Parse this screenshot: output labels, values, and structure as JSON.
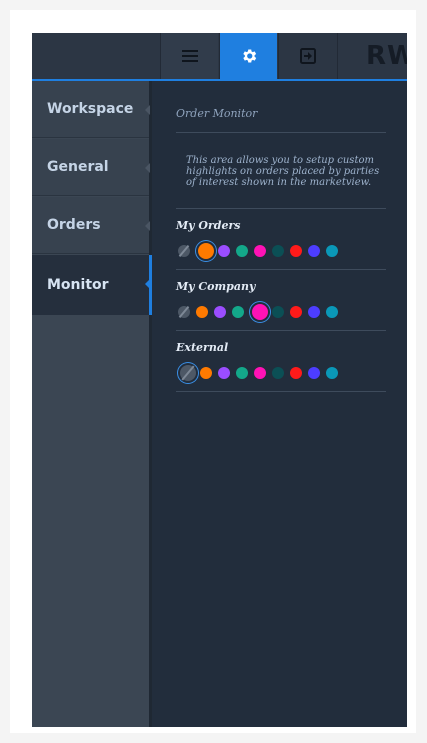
{
  "toolbar": {
    "buttons": [
      {
        "name": "menu",
        "icon": "hamburger-icon"
      },
      {
        "name": "settings",
        "icon": "gear-icon",
        "active": true
      },
      {
        "name": "exit",
        "icon": "sign-in-icon"
      }
    ],
    "logo_text": "RW",
    "accent_color": "#1f7fe0"
  },
  "sidebar": {
    "items": [
      {
        "label": "Workspace",
        "active": false
      },
      {
        "label": "General",
        "active": false
      },
      {
        "label": "Orders",
        "active": false
      },
      {
        "label": "Monitor",
        "active": true
      }
    ]
  },
  "main": {
    "section_title": "Order Monitor",
    "description": "This area allows you to setup custom highlights on orders placed by parties of interest shown in the marketview.",
    "groups": [
      {
        "label": "My Orders",
        "selected_index": 1
      },
      {
        "label": "My Company",
        "selected_index": 4
      },
      {
        "label": "External",
        "selected_index": 0
      }
    ],
    "palette": [
      "none",
      "#ff7a00",
      "#9b4dff",
      "#13a88a",
      "#ff12b5",
      "#0b4f55",
      "#ff1a1a",
      "#4d3dff",
      "#0a98b8"
    ]
  }
}
